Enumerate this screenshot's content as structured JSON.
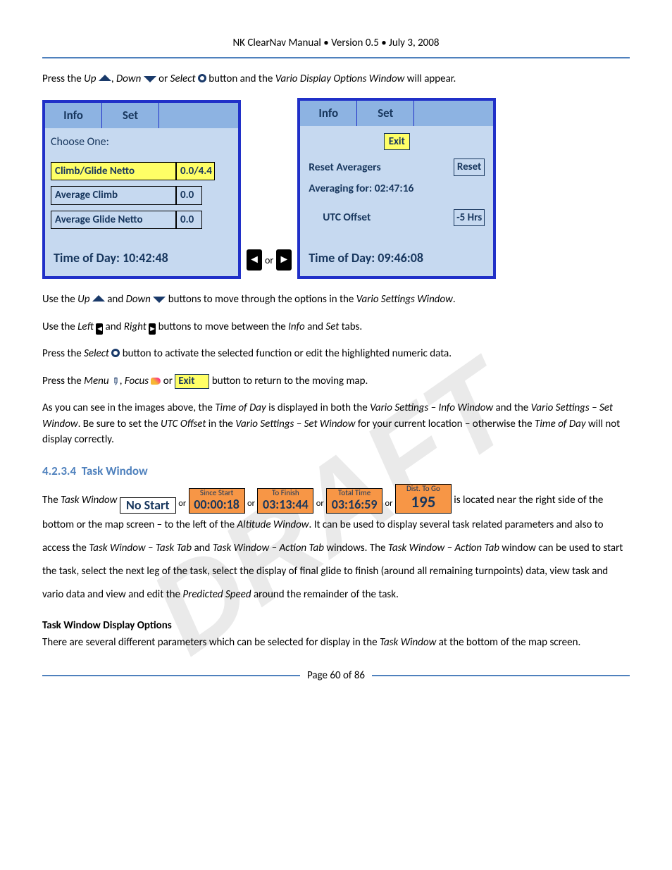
{
  "header": {
    "title": "NK ClearNav Manual • Version 0.5 • July 3, 2008"
  },
  "intro": {
    "t1": "Press the ",
    "up": "Up",
    "t2": ", ",
    "down": "Down",
    "t3": " or ",
    "select": "Select",
    "t4": " button and the ",
    "vdow": "Vario Display Options Window",
    "t5": " will appear."
  },
  "screen1": {
    "tab_info": "Info",
    "tab_set": "Set",
    "choose": "Choose One:",
    "r1_label": "Climb/Glide Netto",
    "r1_val": "0.0/4.4",
    "r2_label": "Average Climb",
    "r2_val": "0.0",
    "r3_label": "Average Glide Netto",
    "r3_val": "0.0",
    "tod": "Time of Day: 10:42:48"
  },
  "between_or": "or",
  "screen2": {
    "tab_info": "Info",
    "tab_set": "Set",
    "exit": "Exit",
    "reset_label": "Reset Averagers",
    "reset_btn": "Reset",
    "averaging": "Averaging for: 02:47:16",
    "utc_label": "UTC Offset",
    "utc_val": "-5 Hrs",
    "tod": "Time of Day: 09:46:08"
  },
  "p2": {
    "t1": "Use the ",
    "up": "Up",
    "t2": " and ",
    "down": "Down",
    "t3": " buttons to move through the options in the ",
    "vsw": "Vario Settings Window",
    "t4": "."
  },
  "p3": {
    "t1": "Use the ",
    "left": "Left",
    "t2": " and ",
    "right": "Right",
    "t3": " buttons to move between the ",
    "info": "Info",
    "t4": " and ",
    "set": "Set",
    "t5": " tabs."
  },
  "p4": {
    "t1": "Press the ",
    "select": "Select",
    "t2": " button to activate the selected function or edit the highlighted numeric data."
  },
  "p5": {
    "t1": "Press the ",
    "menu": "Menu",
    "t2": ", ",
    "focus": "Focus",
    "t3": " or ",
    "exit": "Exit",
    "t4": " button to return to the moving map."
  },
  "p6": {
    "t1": "As you can see in the images above, the ",
    "tod": "Time of Day",
    "t2": " is displayed in both the ",
    "vsi": "Vario Settings – Info Window",
    "t3": " and the ",
    "vss": "Vario Settings – Set Window",
    "t4": ".  Be sure to set the ",
    "utc": "UTC Offset",
    "t5": " in the ",
    "vss2": "Vario Settings – Set Window",
    "t6": " for your current location – otherwise the ",
    "tod2": "Time of Day",
    "t7": " will not display correctly."
  },
  "section": {
    "num": "4.2.3.4",
    "title": "Task Window"
  },
  "task": {
    "t1": "The ",
    "tw": "Task Window",
    "chips": [
      {
        "label": "",
        "value": "No Start",
        "style": "white"
      },
      {
        "label": "Since Start",
        "value": "00:00:18",
        "style": "orange"
      },
      {
        "label": "To Finish",
        "value": "03:13:44",
        "style": "orange"
      },
      {
        "label": "Total Time",
        "value": "03:16:59",
        "style": "orange"
      },
      {
        "label": "Dist. To Go",
        "value": "195",
        "style": "special"
      }
    ],
    "or": "or",
    "t2": " is located near the right side of the bottom or the map screen – to the left of the ",
    "aw": "Altitude Window",
    "t3": ".  It can be used to display several task related parameters and also to access the ",
    "twtt": "Task Window – Task Tab",
    "t4": " and ",
    "twat": "Task Window – Action Tab",
    "t5": " windows.  The ",
    "twat2": "Task Window – Action Tab",
    "t6": " window can be used to start the task, select the next leg of the task, select the display of final glide to finish (around all remaining turnpoints) data, view task and vario data and view and edit the ",
    "ps": "Predicted Speed",
    "t7": " around the remainder of the task."
  },
  "subhead": "Task Window Display Options",
  "p7": {
    "t1": "There are several different parameters which can be selected for display in the ",
    "tw": "Task Window",
    "t2": " at the bottom of the map screen."
  },
  "footer": {
    "page": "Page 60 of 86"
  }
}
